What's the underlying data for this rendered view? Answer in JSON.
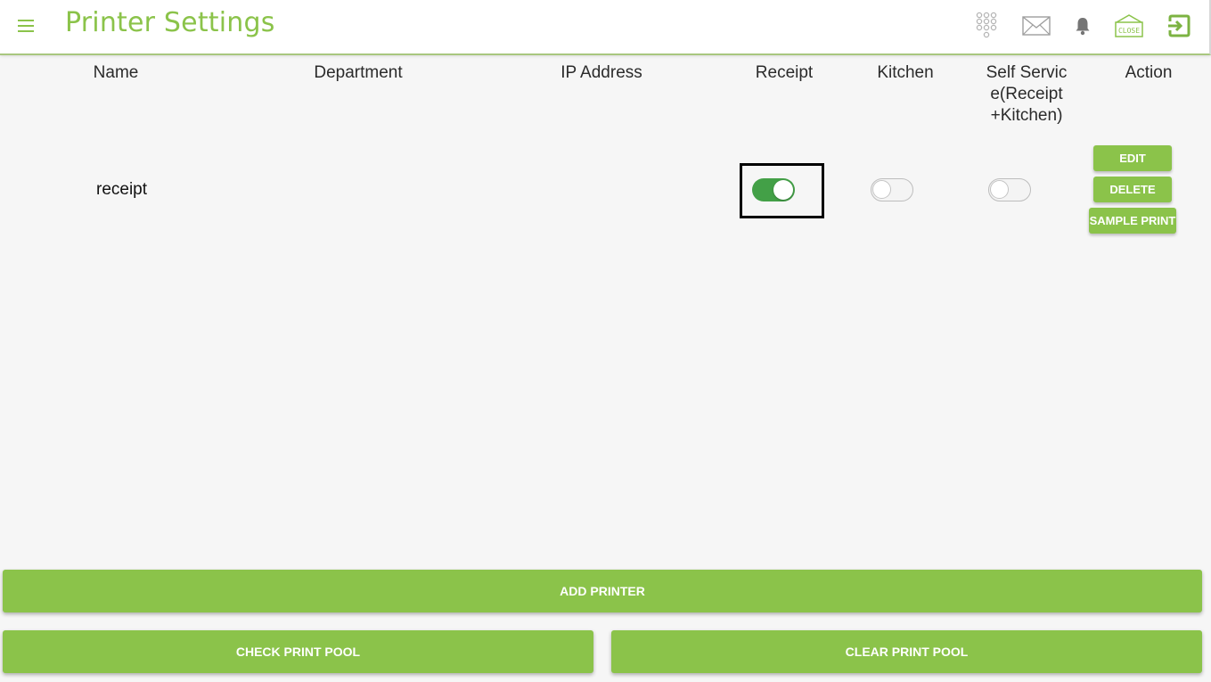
{
  "header": {
    "title": "Printer Settings",
    "icons": [
      "menu-icon",
      "keypad-icon",
      "mail-icon",
      "bell-icon",
      "close-shop-icon",
      "logout-icon"
    ],
    "close_icon_text": "CLOSE"
  },
  "table": {
    "columns": {
      "name": "Name",
      "department": "Department",
      "ip": "IP Address",
      "receipt": "Receipt",
      "kitchen": "Kitchen",
      "self_service_line1": "Self Servic",
      "self_service_line2": "e(Receipt",
      "self_service_line3": "+Kitchen)",
      "action": "Action"
    },
    "rows": [
      {
        "name": "receipt",
        "department": "",
        "ip": "",
        "receipt_enabled": true,
        "kitchen_enabled": false,
        "self_service_enabled": false,
        "actions": {
          "edit": "EDIT",
          "delete": "DELETE",
          "sample": "SAMPLE PRINT"
        }
      }
    ]
  },
  "footer": {
    "add_printer": "ADD PRINTER",
    "check_pool": "CHECK PRINT POOL",
    "clear_pool": "CLEAR PRINT POOL"
  },
  "colors": {
    "accent": "#8bc34a",
    "toggle_on": "#43a047",
    "background": "#f6f6f6"
  }
}
